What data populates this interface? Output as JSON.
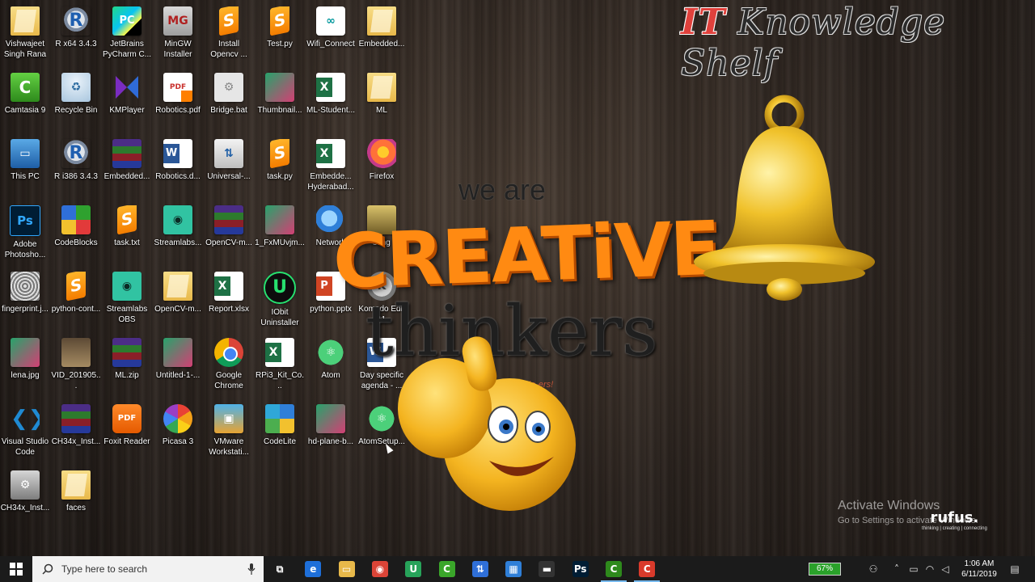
{
  "desktop": {
    "icons": [
      {
        "label": "Vishwajeet Singh Rana",
        "icon": "folder-user-icon"
      },
      {
        "label": "R x64 3.4.3",
        "icon": "r-icon"
      },
      {
        "label": "JetBrains PyCharm C...",
        "icon": "pycharm-icon"
      },
      {
        "label": "MinGW Installer",
        "icon": "mingw-icon"
      },
      {
        "label": "Install Opencv ...",
        "icon": "sublime-file-icon"
      },
      {
        "label": "Test.py",
        "icon": "sublime-file-icon"
      },
      {
        "label": "Wifi_Connect",
        "icon": "arduino-icon"
      },
      {
        "label": "Embedded...",
        "icon": "folder-icon"
      },
      {
        "label": "Camtasia 9",
        "icon": "camtasia-icon"
      },
      {
        "label": "Recycle Bin",
        "icon": "recycle-bin-icon"
      },
      {
        "label": "KMPlayer",
        "icon": "kmplayer-icon"
      },
      {
        "label": "Robotics.pdf",
        "icon": "pdf-icon"
      },
      {
        "label": "Bridge.bat",
        "icon": "bat-file-icon"
      },
      {
        "label": "Thumbnail...",
        "icon": "image-icon"
      },
      {
        "label": "ML-Student...",
        "icon": "excel-icon"
      },
      {
        "label": "ML",
        "icon": "folder-icon"
      },
      {
        "label": "This PC",
        "icon": "computer-icon"
      },
      {
        "label": "R i386 3.4.3",
        "icon": "r-icon"
      },
      {
        "label": "Embedded...",
        "icon": "winrar-icon"
      },
      {
        "label": "Robotics.d...",
        "icon": "word-icon"
      },
      {
        "label": "Universal-...",
        "icon": "usb-installer-icon"
      },
      {
        "label": "task.py",
        "icon": "sublime-file-icon"
      },
      {
        "label": "Embedde... Hyderabad...",
        "icon": "excel-icon"
      },
      {
        "label": "Firefox",
        "icon": "firefox-icon"
      },
      {
        "label": "Adobe Photosho...",
        "icon": "photoshop-icon"
      },
      {
        "label": "CodeBlocks",
        "icon": "codeblocks-icon"
      },
      {
        "label": "task.txt",
        "icon": "sublime-file-icon"
      },
      {
        "label": "Streamlabs...",
        "icon": "streamlabs-icon"
      },
      {
        "label": "OpenCV-m...",
        "icon": "winrar-icon"
      },
      {
        "label": "1_FxMUvjm...",
        "icon": "image-icon"
      },
      {
        "label": "Network",
        "icon": "network-icon"
      },
      {
        "label": "song",
        "icon": "music-folder-icon"
      },
      {
        "label": "fingerprint.j...",
        "icon": "fingerprint-image-icon"
      },
      {
        "label": "python-cont...",
        "icon": "sublime-file-icon"
      },
      {
        "label": "Streamlabs OBS",
        "icon": "streamlabs-icon"
      },
      {
        "label": "OpenCV-m...",
        "icon": "folder-icon"
      },
      {
        "label": "Report.xlsx",
        "icon": "excel-icon"
      },
      {
        "label": "IObit Uninstaller",
        "icon": "iobit-icon"
      },
      {
        "label": "python.pptx",
        "icon": "powerpoint-icon"
      },
      {
        "label": "Komodo Edit 11",
        "icon": "komodo-icon"
      },
      {
        "label": "lena.jpg",
        "icon": "image-icon"
      },
      {
        "label": "VID_201905...",
        "icon": "video-icon"
      },
      {
        "label": "ML.zip",
        "icon": "winrar-icon"
      },
      {
        "label": "Untitled-1-...",
        "icon": "image-icon"
      },
      {
        "label": "Google Chrome",
        "icon": "chrome-icon"
      },
      {
        "label": "RPi3_Kit_Co...",
        "icon": "excel-icon"
      },
      {
        "label": "Atom",
        "icon": "atom-icon"
      },
      {
        "label": "Day specific agenda - ...",
        "icon": "word-icon"
      },
      {
        "label": "Visual Studio Code",
        "icon": "vscode-icon"
      },
      {
        "label": "CH34x_Inst...",
        "icon": "winrar-icon"
      },
      {
        "label": "Foxit Reader",
        "icon": "foxit-icon"
      },
      {
        "label": "Picasa 3",
        "icon": "picasa-icon"
      },
      {
        "label": "VMware Workstati...",
        "icon": "vmware-icon"
      },
      {
        "label": "CodeLite",
        "icon": "codelite-icon"
      },
      {
        "label": "hd-plane-b...",
        "icon": "image-icon"
      },
      {
        "label": "AtomSetup...",
        "icon": "atom-icon"
      },
      {
        "label": "CH34x_Inst...",
        "icon": "setup-icon"
      },
      {
        "label": "faces",
        "icon": "folder-icon"
      }
    ]
  },
  "wallpaper": {
    "brand_it": "IT",
    "brand_rest": "Knowledge Shelf",
    "we_are": "we are",
    "creative": "CREATiVE",
    "thinkers": "thinkers",
    "tagline": "and innovative do-ers!"
  },
  "watermark": {
    "activate_title": "Activate Windows",
    "activate_sub": "Go to Settings to activate Windows.",
    "rufus_name": "rufus.",
    "rufus_tag": "thinking | creating | connecting"
  },
  "taskbar": {
    "search_placeholder": "Type here to search",
    "pinned": [
      {
        "name": "task-view-icon",
        "glyph": "⧉",
        "color": "#1b1b1b",
        "active": false
      },
      {
        "name": "edge-icon",
        "glyph": "e",
        "color": "#1e6fd9",
        "active": false
      },
      {
        "name": "file-explorer-icon",
        "glyph": "▭",
        "color": "#e8b94a",
        "active": false
      },
      {
        "name": "chrome-icon",
        "glyph": "◉",
        "color": "#db4437",
        "active": false
      },
      {
        "name": "iobit-icon",
        "glyph": "U",
        "color": "#27a35a",
        "active": false
      },
      {
        "name": "camtasia-icon",
        "glyph": "C",
        "color": "#3aa62a",
        "active": false
      },
      {
        "name": "usb-installer-icon",
        "glyph": "⇅",
        "color": "#2f6fd8",
        "active": false
      },
      {
        "name": "store-icon",
        "glyph": "▦",
        "color": "#2f7fd8",
        "active": false
      },
      {
        "name": "terminal-icon",
        "glyph": "▬",
        "color": "#333333",
        "active": false
      },
      {
        "name": "photoshop-icon",
        "glyph": "Ps",
        "color": "#001d34",
        "active": false
      },
      {
        "name": "camtasia-recorder-icon",
        "glyph": "C",
        "color": "#2e8a1c",
        "active": true
      },
      {
        "name": "camtasia-rec-icon",
        "glyph": "C",
        "color": "#d93a2b",
        "active": true
      }
    ],
    "battery_percent": "67%",
    "time": "1:06 AM",
    "date": "6/11/2019"
  }
}
